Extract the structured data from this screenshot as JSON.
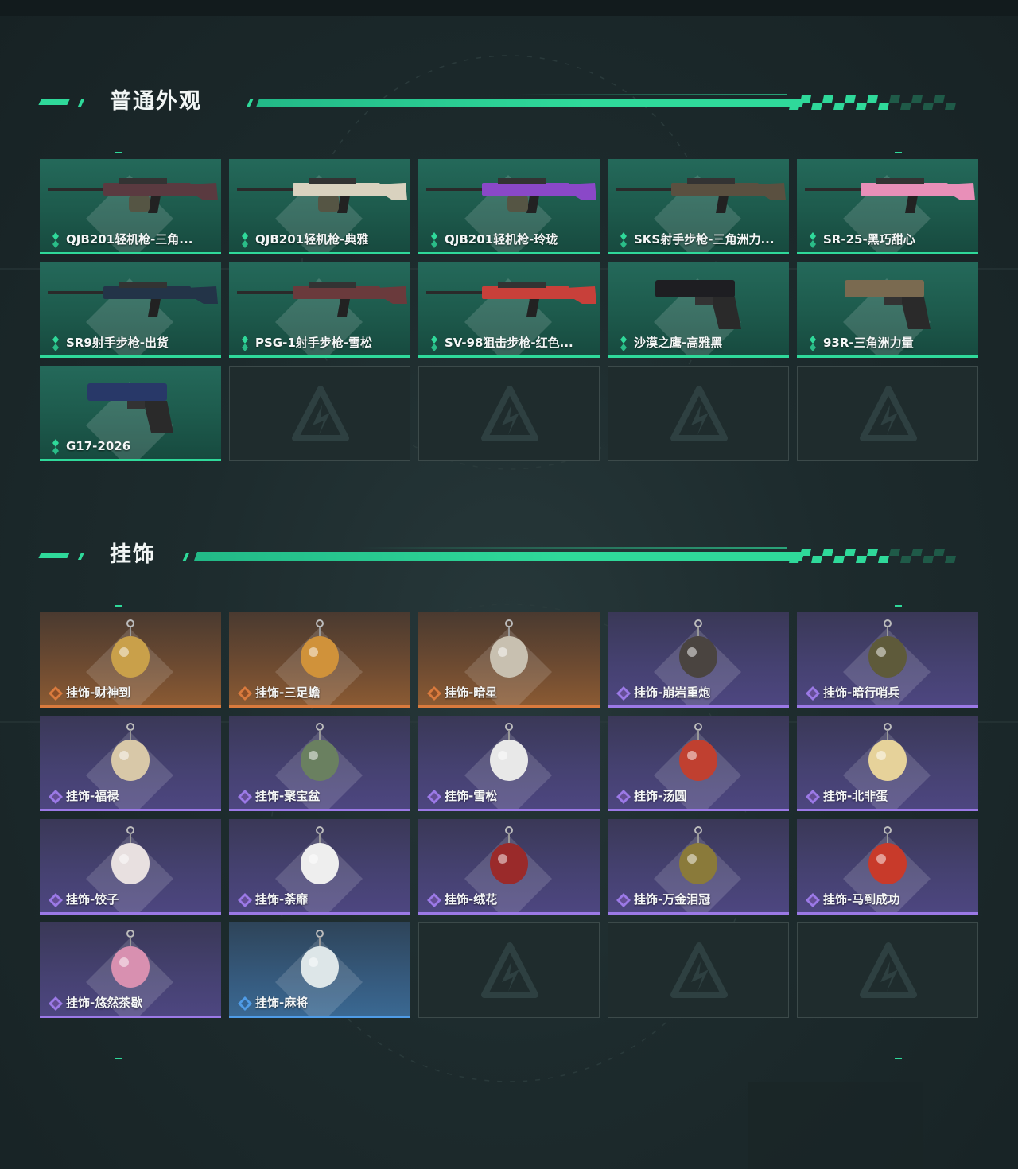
{
  "colors": {
    "accent": "#2fd99a",
    "rarity_green": "#2fd99a",
    "rarity_orange": "#d97a3d",
    "rarity_purple": "#9b79e6",
    "rarity_blue": "#4f9be6"
  },
  "sections": [
    {
      "title": "普通外观",
      "items": [
        {
          "label": "QJB201轻机枪-三角...",
          "rarity": "green",
          "icon": "light-machine-gun-icon"
        },
        {
          "label": "QJB201轻机枪-典雅",
          "rarity": "green",
          "icon": "light-machine-gun-icon"
        },
        {
          "label": "QJB201轻机枪-玲珑",
          "rarity": "green",
          "icon": "light-machine-gun-icon"
        },
        {
          "label": "SKS射手步枪-三角洲力...",
          "rarity": "green",
          "icon": "marksman-rifle-icon"
        },
        {
          "label": "SR-25-黑巧甜心",
          "rarity": "green",
          "icon": "marksman-rifle-icon"
        },
        {
          "label": "SR9射手步枪-出货",
          "rarity": "green",
          "icon": "marksman-rifle-icon"
        },
        {
          "label": "PSG-1射手步枪-雪松",
          "rarity": "green",
          "icon": "sniper-rifle-icon"
        },
        {
          "label": "SV-98狙击步枪-红色...",
          "rarity": "green",
          "icon": "sniper-rifle-icon"
        },
        {
          "label": "沙漠之鹰-高雅黑",
          "rarity": "green",
          "icon": "pistol-icon"
        },
        {
          "label": "93R-三角洲力量",
          "rarity": "green",
          "icon": "pistol-icon"
        },
        {
          "label": "G17-2026",
          "rarity": "green",
          "icon": "pistol-icon"
        },
        {
          "label": "",
          "rarity": "empty"
        },
        {
          "label": "",
          "rarity": "empty"
        },
        {
          "label": "",
          "rarity": "empty"
        },
        {
          "label": "",
          "rarity": "empty"
        }
      ]
    },
    {
      "title": "挂饰",
      "items": [
        {
          "label": "挂饰-财神到",
          "rarity": "orange",
          "icon": "charm-icon"
        },
        {
          "label": "挂饰-三足蟾",
          "rarity": "orange",
          "icon": "charm-icon"
        },
        {
          "label": "挂饰-暗星",
          "rarity": "orange",
          "icon": "charm-icon"
        },
        {
          "label": "挂饰-崩岩重炮",
          "rarity": "purple",
          "icon": "charm-icon"
        },
        {
          "label": "挂饰-暗行哨兵",
          "rarity": "purple",
          "icon": "charm-icon"
        },
        {
          "label": "挂饰-福禄",
          "rarity": "purple",
          "icon": "charm-icon"
        },
        {
          "label": "挂饰-聚宝盆",
          "rarity": "purple",
          "icon": "charm-icon"
        },
        {
          "label": "挂饰-雪松",
          "rarity": "purple",
          "icon": "charm-icon"
        },
        {
          "label": "挂饰-汤圆",
          "rarity": "purple",
          "icon": "charm-icon"
        },
        {
          "label": "挂饰-北非蛋",
          "rarity": "purple",
          "icon": "charm-icon"
        },
        {
          "label": "挂饰-饺子",
          "rarity": "purple",
          "icon": "charm-icon"
        },
        {
          "label": "挂饰-荼靡",
          "rarity": "purple",
          "icon": "charm-icon"
        },
        {
          "label": "挂饰-绒花",
          "rarity": "purple",
          "icon": "charm-icon"
        },
        {
          "label": "挂饰-万金泪冠",
          "rarity": "purple",
          "icon": "charm-icon"
        },
        {
          "label": "挂饰-马到成功",
          "rarity": "purple",
          "icon": "charm-icon"
        },
        {
          "label": "挂饰-悠然茶歇",
          "rarity": "purple",
          "icon": "charm-icon"
        },
        {
          "label": "挂饰-麻将",
          "rarity": "blue",
          "icon": "charm-icon"
        },
        {
          "label": "",
          "rarity": "empty"
        },
        {
          "label": "",
          "rarity": "empty"
        },
        {
          "label": "",
          "rarity": "empty"
        }
      ]
    }
  ]
}
